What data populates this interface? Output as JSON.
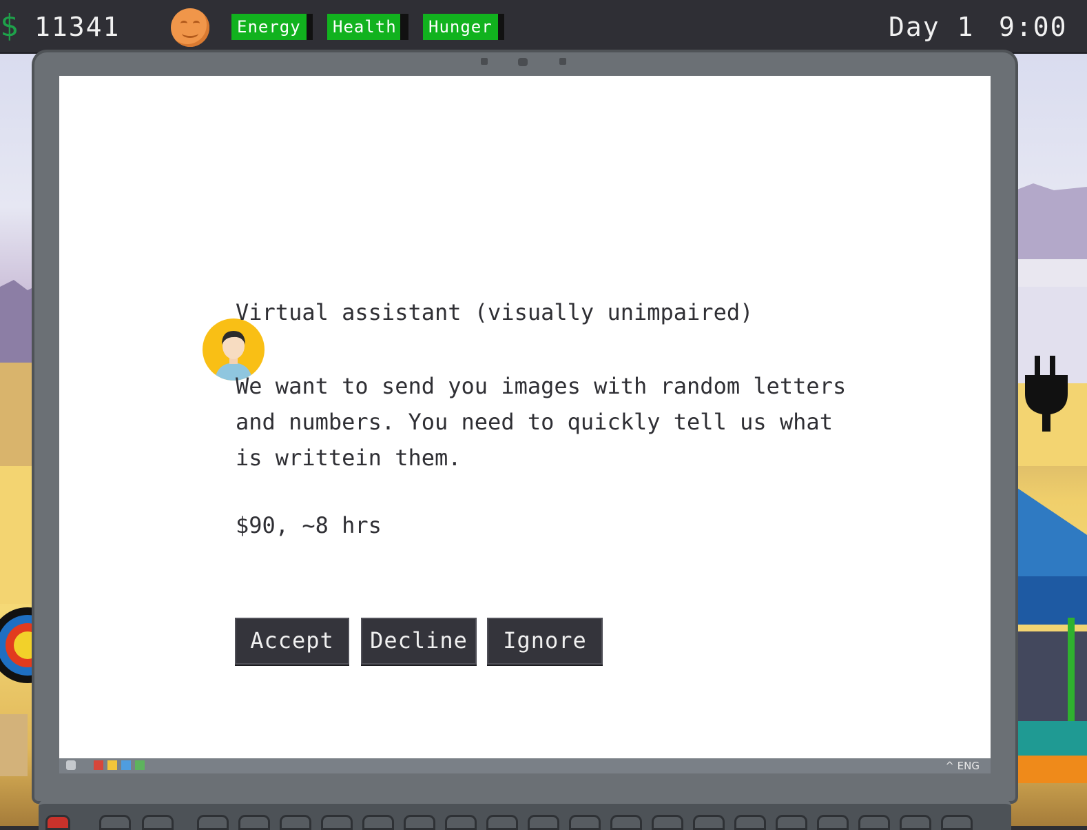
{
  "hud": {
    "money_icon": "$",
    "money": "11341",
    "mood_icon": "smiling-face-icon",
    "stats": [
      {
        "label": "Energy",
        "level": 0.92
      },
      {
        "label": "Health",
        "level": 0.9
      },
      {
        "label": "Hunger",
        "level": 0.92
      }
    ],
    "day": "Day 1",
    "time": "9:00"
  },
  "job": {
    "title": "Virtual assistant (visually unimpaired)",
    "description": "We want to send you images with random letters and numbers. You need to quickly tell us what is writtein them.",
    "pay": "$90, ~8 hrs",
    "buttons": {
      "accept": "Accept",
      "decline": "Decline",
      "ignore": "Ignore"
    }
  },
  "taskbar": {
    "language": "^ ENG"
  },
  "colors": {
    "stat_bar": "#11b21e",
    "money_icon": "#1ea14a",
    "button_bg": "#34343b",
    "avatar_bg": "#f9bf15"
  }
}
